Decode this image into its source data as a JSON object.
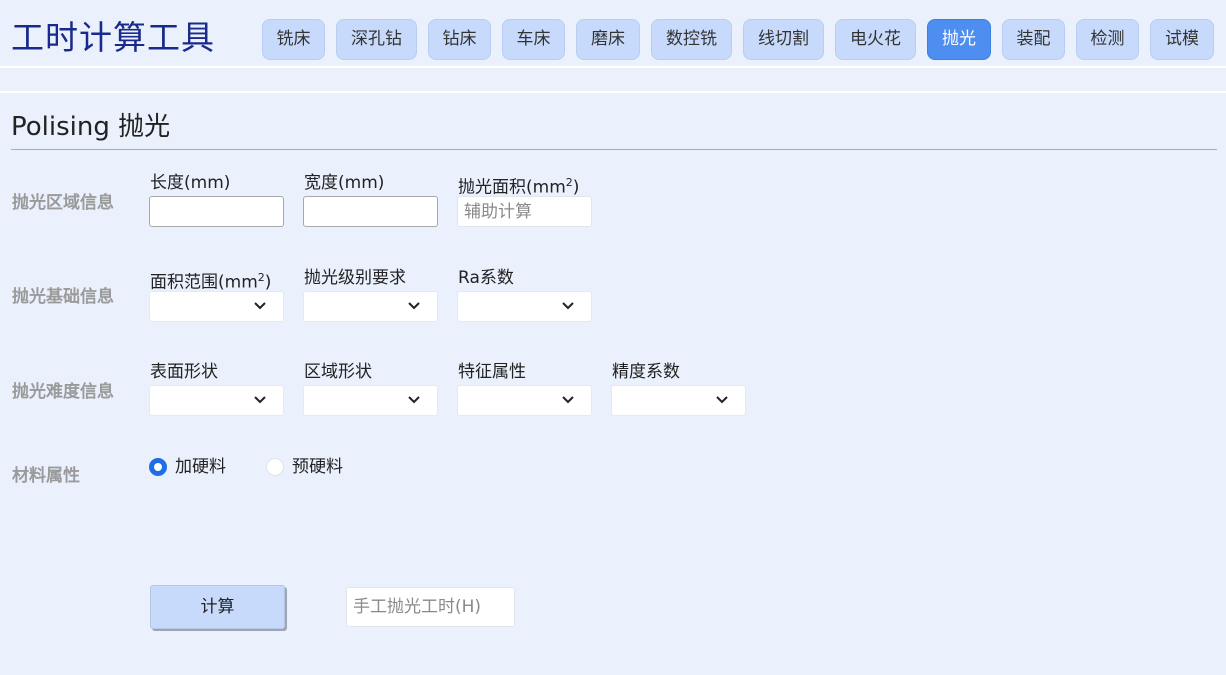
{
  "app_title": "工时计算工具",
  "nav": {
    "tabs": [
      {
        "label": "铣床",
        "active": false
      },
      {
        "label": "深孔钻",
        "active": false
      },
      {
        "label": "钻床",
        "active": false
      },
      {
        "label": "车床",
        "active": false
      },
      {
        "label": "磨床",
        "active": false
      },
      {
        "label": "数控铣",
        "active": false
      },
      {
        "label": "线切割",
        "active": false
      },
      {
        "label": "电火花",
        "active": false
      },
      {
        "label": "抛光",
        "active": true
      },
      {
        "label": "装配",
        "active": false
      },
      {
        "label": "检测",
        "active": false
      },
      {
        "label": "试模",
        "active": false
      }
    ]
  },
  "page_title": "Polising 抛光",
  "sections": {
    "area_info": {
      "label": "抛光区域信息",
      "length_label": "长度(mm)",
      "width_label": "宽度(mm)",
      "area_label": "抛光面积(mm",
      "area_sup": "2",
      "area_sup_close": ")",
      "area_placeholder": "辅助计算"
    },
    "basic_info": {
      "label": "抛光基础信息",
      "range_label": "面积范围(mm",
      "range_sup": "2",
      "range_sup_close": ")",
      "level_label": "抛光级别要求",
      "ra_label": "Ra系数"
    },
    "difficulty_info": {
      "label": "抛光难度信息",
      "surface_label": "表面形状",
      "region_label": "区域形状",
      "feature_label": "特征属性",
      "precision_label": "精度系数"
    },
    "material": {
      "label": "材料属性",
      "options": [
        {
          "label": "加硬料",
          "selected": true
        },
        {
          "label": "预硬料",
          "selected": false
        }
      ]
    }
  },
  "actions": {
    "calc_label": "计算",
    "result_placeholder": "手工抛光工时(H)"
  },
  "colors": {
    "background": "#eaf1fd",
    "tab": "#c7dafb",
    "tab_active": "#4d8ef0",
    "title": "#1a2a8c",
    "radio_on": "#1f6ee8"
  }
}
